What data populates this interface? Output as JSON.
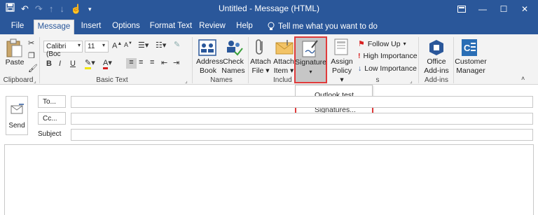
{
  "window": {
    "title": "Untitled  -  Message (HTML)",
    "qat_icons": [
      "save-icon",
      "undo-icon",
      "redo-icon",
      "up-arrow-icon",
      "down-arrow-icon",
      "touch-icon",
      "customize-icon"
    ]
  },
  "tabs": [
    "File",
    "Message",
    "Insert",
    "Options",
    "Format Text",
    "Review",
    "Help"
  ],
  "tell_me": "Tell me what you want to do",
  "ribbon": {
    "clipboard": {
      "paste": "Paste",
      "label": "Clipboard"
    },
    "basic_text": {
      "font": "Calibri (Boc",
      "size": "11",
      "label": "Basic Text"
    },
    "names": {
      "address_book": [
        "Address",
        "Book"
      ],
      "check_names": [
        "Check",
        "Names"
      ],
      "label": "Names"
    },
    "include": {
      "attach_file": [
        "Attach",
        "File"
      ],
      "attach_item": [
        "Attach",
        "Item"
      ],
      "signature": "Signature",
      "assign_policy": [
        "Assign",
        "Policy"
      ],
      "label": "Includ"
    },
    "tags": {
      "follow_up": "Follow Up",
      "high": "High Importance",
      "low": "Low Importance",
      "label_tail": "s"
    },
    "addins": {
      "office": [
        "Office",
        "Add-ins"
      ],
      "label": "Add-ins"
    },
    "customer_manager": [
      "Customer",
      "Manager"
    ]
  },
  "header": {
    "send": "Send",
    "to": "To...",
    "cc": "Cc...",
    "subject": "Subject"
  },
  "signature_menu": {
    "items": [
      "Outlook test email",
      "Signatures..."
    ]
  },
  "colors": {
    "titlebar": "#2a579a",
    "highlight": "#e03a3a"
  }
}
